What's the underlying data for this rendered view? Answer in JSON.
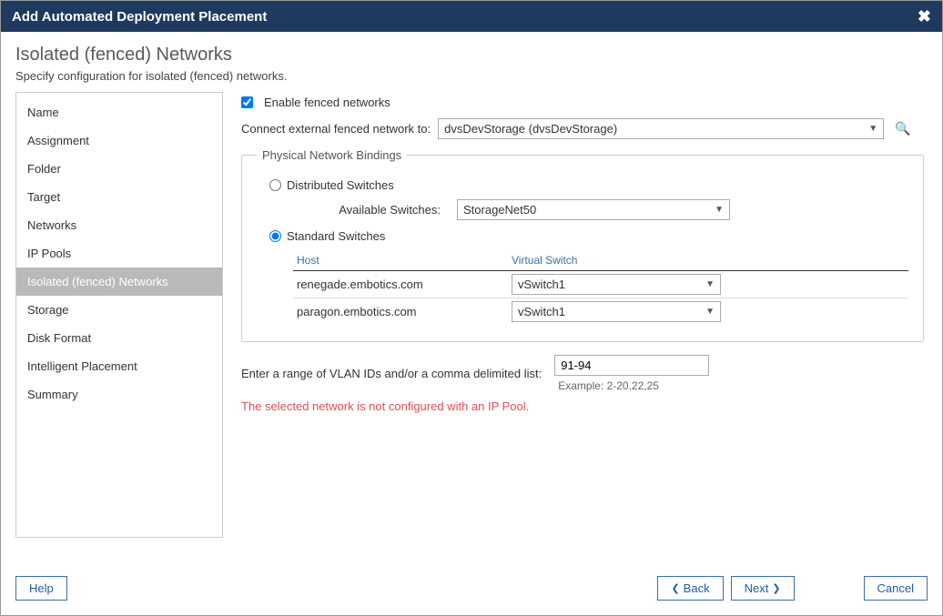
{
  "titlebar": {
    "title": "Add Automated Deployment Placement"
  },
  "header": {
    "heading": "Isolated (fenced) Networks",
    "subtitle": "Specify configuration for isolated (fenced) networks."
  },
  "sidebar": {
    "items": [
      {
        "label": "Name",
        "selected": false
      },
      {
        "label": "Assignment",
        "selected": false
      },
      {
        "label": "Folder",
        "selected": false
      },
      {
        "label": "Target",
        "selected": false
      },
      {
        "label": "Networks",
        "selected": false
      },
      {
        "label": "IP Pools",
        "selected": false
      },
      {
        "label": "Isolated (fenced) Networks",
        "selected": true
      },
      {
        "label": "Storage",
        "selected": false
      },
      {
        "label": "Disk Format",
        "selected": false
      },
      {
        "label": "Intelligent Placement",
        "selected": false
      },
      {
        "label": "Summary",
        "selected": false
      }
    ]
  },
  "form": {
    "enable_label": "Enable fenced networks",
    "enable_checked": true,
    "connect_label": "Connect external fenced network to:",
    "connect_value": "dvsDevStorage (dvsDevStorage)",
    "bindings_legend": "Physical Network Bindings",
    "dist_label": "Distributed Switches",
    "dist_selected": false,
    "avail_label": "Available Switches:",
    "avail_value": "StorageNet50",
    "std_label": "Standard Switches",
    "std_selected": true,
    "host_col": "Host",
    "vswitch_col": "Virtual Switch",
    "hosts": [
      {
        "host": "renegade.embotics.com",
        "vswitch": "vSwitch1"
      },
      {
        "host": "paragon.embotics.com",
        "vswitch": "vSwitch1"
      }
    ],
    "vlan_label": "Enter a range of VLAN IDs and/or a comma delimited list:",
    "vlan_value": "91-94",
    "vlan_example": "Example: 2-20,22,25",
    "warning": "The selected network is not configured with an IP Pool."
  },
  "footer": {
    "help": "Help",
    "back": "Back",
    "next": "Next",
    "cancel": "Cancel"
  }
}
